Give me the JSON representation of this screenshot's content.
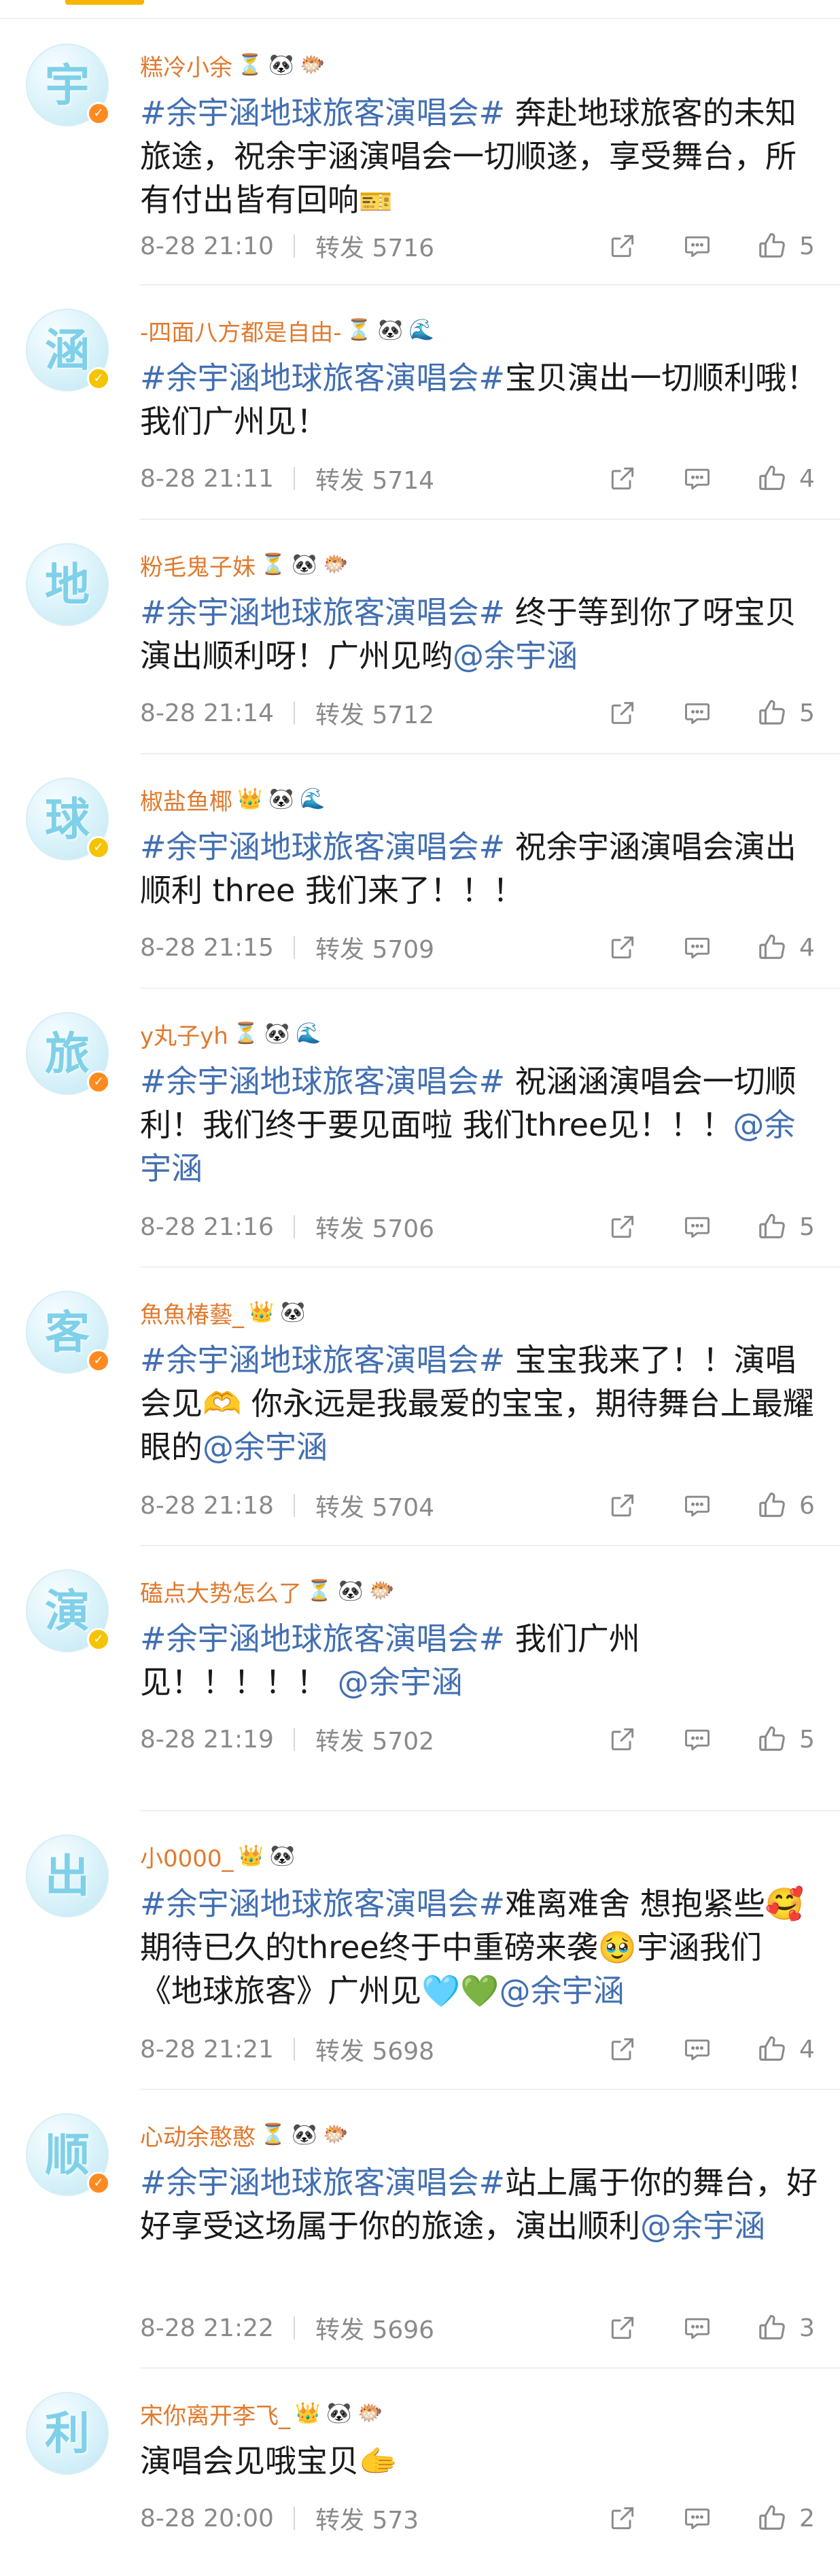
{
  "comments": [
    {
      "avatar_char": "宇",
      "badge_color": "orange",
      "username": "糕冷小余",
      "badges": [
        "⏳",
        "🐼",
        "🐡"
      ],
      "hashtag": "#余宇涵地球旅客演唱会#",
      "text": " 奔赴地球旅客的未知旅途，祝余宇涵演唱会一切顺遂，享受舞台，所有付出皆有回响",
      "emoji_after": "🎫",
      "mention": "",
      "text_after_mention": "",
      "time": "8-28 21:10",
      "repost": "转发 5716",
      "likes": "5"
    },
    {
      "avatar_char": "涵",
      "badge_color": "yellow",
      "username": "-四面八方都是自由-",
      "badges": [
        "⏳",
        "🐼",
        "🌊"
      ],
      "hashtag": "#余宇涵地球旅客演唱会#",
      "text": "宝贝演出一切顺利哦！我们广州见！",
      "emoji_after": "",
      "mention": "",
      "text_after_mention": "",
      "time": "8-28 21:11",
      "repost": "转发 5714",
      "likes": "4"
    },
    {
      "avatar_char": "地",
      "badge_color": "none",
      "username": "粉毛鬼子妹",
      "badges": [
        "⏳",
        "🐼",
        "🐡"
      ],
      "hashtag": "#余宇涵地球旅客演唱会#",
      "text": " 终于等到你了呀宝贝 演出顺利呀！广州见哟",
      "emoji_after": "",
      "mention": "@余宇涵",
      "text_after_mention": "",
      "time": "8-28 21:14",
      "repost": "转发 5712",
      "likes": "5"
    },
    {
      "avatar_char": "球",
      "badge_color": "yellow",
      "username": "椒盐鱼椰",
      "badges": [
        "👑",
        "🐼",
        "🌊"
      ],
      "hashtag": "#余宇涵地球旅客演唱会#",
      "text": " 祝余宇涵演唱会演出顺利 three 我们来了！！！",
      "emoji_after": "",
      "mention": "",
      "text_after_mention": "",
      "time": "8-28 21:15",
      "repost": "转发 5709",
      "likes": "4"
    },
    {
      "avatar_char": "旅",
      "badge_color": "orange",
      "username": "y丸子yh",
      "badges": [
        "⏳",
        "🐼",
        "🌊"
      ],
      "hashtag": "#余宇涵地球旅客演唱会#",
      "text": " 祝涵涵演唱会一切顺利！我们终于要见面啦  我们three见！！！",
      "emoji_after": "",
      "mention": "@余宇涵",
      "text_after_mention": "",
      "time": "8-28 21:16",
      "repost": "转发 5706",
      "likes": "5"
    },
    {
      "avatar_char": "客",
      "badge_color": "orange",
      "username": "魚魚椿藝_",
      "badges": [
        "👑",
        "🐼"
      ],
      "hashtag": "#余宇涵地球旅客演唱会#",
      "text": " 宝宝我来了！！演唱会见🫶 你永远是我最爱的宝宝，期待舞台上最耀眼的",
      "emoji_after": "",
      "mention": "@余宇涵",
      "text_after_mention": "",
      "time": "8-28 21:18",
      "repost": "转发 5704",
      "likes": "6"
    },
    {
      "avatar_char": "演",
      "badge_color": "yellow",
      "username": "磕点大势怎么了",
      "badges": [
        "⏳",
        "🐼",
        "🐡"
      ],
      "hashtag": "#余宇涵地球旅客演唱会#",
      "text": "  我们广州见！！！！！ ",
      "emoji_after": "",
      "mention": "@余宇涵",
      "text_after_mention": "",
      "time": "8-28 21:19",
      "repost": "转发 5702",
      "likes": "5"
    },
    {
      "avatar_char": "出",
      "badge_color": "none",
      "username": "小0000_",
      "badges": [
        "👑",
        "🐼"
      ],
      "hashtag": "#余宇涵地球旅客演唱会#",
      "text": "难离难舍 想抱紧些🥰期待已久的three终于中重磅来袭🥹宇涵我们《地球旅客》广州见🩵💚",
      "emoji_after": "",
      "mention": "@余宇涵",
      "text_after_mention": "",
      "time": "8-28 21:21",
      "repost": "转发 5698",
      "likes": "4"
    },
    {
      "avatar_char": "顺",
      "badge_color": "orange",
      "username": "心动余憨憨",
      "badges": [
        "⏳",
        "🐼",
        "🐡"
      ],
      "hashtag": "#余宇涵地球旅客演唱会#",
      "text": "站上属于你的舞台，好好享受这场属于你的旅途，演出顺利",
      "emoji_after": "",
      "mention": "@余宇涵",
      "text_after_mention": "",
      "time": "8-28 21:22",
      "repost": "转发 5696",
      "likes": "3"
    },
    {
      "avatar_char": "利",
      "badge_color": "none",
      "username": "宋你离开李飞_",
      "badges": [
        "👑",
        "🐼",
        "🐡"
      ],
      "hashtag": "",
      "text": "演唱会见哦宝贝🫱",
      "emoji_after": "",
      "mention": "",
      "text_after_mention": "",
      "time": "8-28 20:00",
      "repost": "转发 573",
      "likes": "2"
    }
  ],
  "icons": {
    "share": "share-icon",
    "comment": "comment-icon",
    "like": "like-icon"
  },
  "colors": {
    "username": "#e07a2e",
    "link": "#426fb1",
    "meta": "#8a8a8a",
    "accent": "#f5b400"
  }
}
